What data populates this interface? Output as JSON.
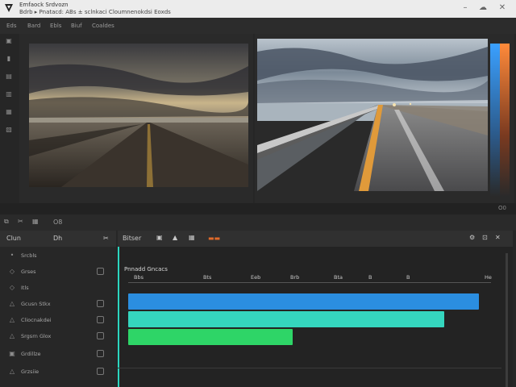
{
  "window": {
    "title": "Emfaock Srdvozn",
    "subtitle": "Bdrb ▸     Pnatacd: ABs ± sclnkaci Cloumnenokdsi Eoxds",
    "controls": [
      "–",
      "☁",
      "✕"
    ]
  },
  "menubar": {
    "items": [
      "Eds",
      "Bard",
      "Ebls",
      "Biuf",
      "Coaldes"
    ]
  },
  "tools": {
    "icons": [
      "▣",
      "▮",
      "▤",
      "▥",
      "▦",
      "▧"
    ]
  },
  "timeline_toolbar": {
    "icons": [
      "⧉",
      "✂",
      "▦"
    ],
    "zoom_label": "O8"
  },
  "left_panel": {
    "header_label": "Clun",
    "header_tab": "Dh",
    "header_icon": "✂",
    "tracks": [
      {
        "icon": "•",
        "label": "Srcbls"
      },
      {
        "icon": "◇",
        "label": "Grses"
      },
      {
        "icon": "◇",
        "label": "Itls"
      },
      {
        "icon": "△",
        "label": "Gcusn Stkx"
      },
      {
        "icon": "△",
        "label": "Cliocnakdei"
      },
      {
        "icon": "△",
        "label": "Srgsrn Glox"
      },
      {
        "icon": "▣",
        "label": "Grdillze"
      },
      {
        "icon": "△",
        "label": "Grzsiie"
      }
    ]
  },
  "main_panel": {
    "header_label": "Bitser",
    "header_icons": [
      "▣",
      "▲",
      "▦"
    ],
    "header_accent": "▬▬",
    "header_right_icons": [
      "⚙",
      "⊡",
      "✕"
    ],
    "section_title": "Pnnadd Gncacs",
    "ticks": [
      "Bbs",
      "Bts",
      "Eeb",
      "Brb",
      "Bta",
      "B",
      "B",
      "He"
    ],
    "bars": [
      {
        "color": "#2b8ee0",
        "value": 1.0
      },
      {
        "color": "#35d6be",
        "value": 0.9
      },
      {
        "color": "#2ed567",
        "value": 0.47
      }
    ]
  },
  "misc": {
    "strip_right": "O0"
  }
}
